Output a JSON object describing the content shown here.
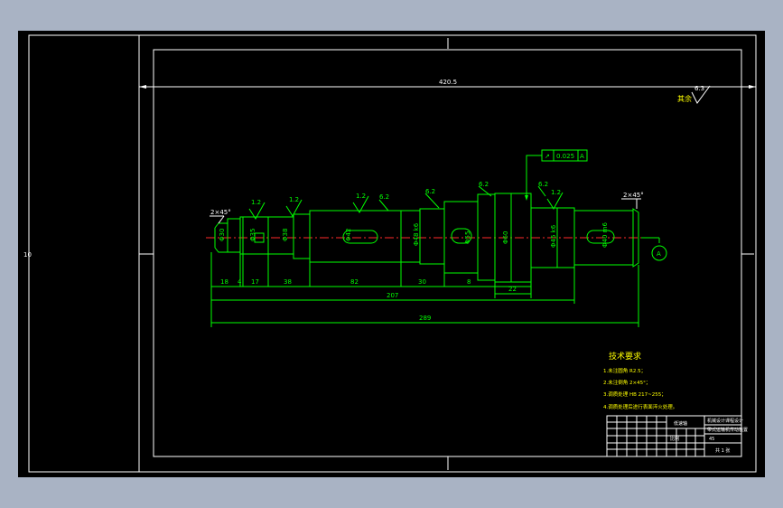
{
  "drawing": {
    "overall_width_dim": "420.5",
    "left_margin_mark": "10",
    "surface_finish_note": {
      "label": "其余",
      "value": "6.3"
    },
    "gdt_frame": {
      "symbol": "↗",
      "tolerance": "0.025",
      "datum": "A"
    },
    "chamfer_left": "2×45°",
    "chamfer_right": "2×45°",
    "roughness_marks": [
      "1.2",
      "1.2",
      "1.2",
      "1.2"
    ],
    "roughness_labels": [
      "6.2",
      "6.2",
      "6.2",
      "6.2"
    ],
    "diameter_labels": [
      "Φ30",
      "Φ35",
      "Φ38",
      "Φ42",
      "Φ48 k6",
      "Φ55",
      "Φ60",
      "Φ45 k6",
      "Φ40 m6"
    ],
    "segment_dims": [
      "18",
      "4",
      "17",
      "38",
      "82",
      "30",
      "8"
    ],
    "sub_dims": [
      "22",
      "207"
    ],
    "total_length": "289",
    "datum_label": "A",
    "tech_requirements": {
      "title": "技术要求",
      "items": [
        "1.未注圆角 R2.5；",
        "2.未注倒角 2×45°；",
        "3.调质处理 HB 217~255；",
        "4.调质处理后进行表面淬火处理。"
      ]
    },
    "title_block": {
      "part_name": "低速轴",
      "school": "机械设计课程设计",
      "drawing_title": "带式运输机传动装置",
      "scale_label": "比例",
      "material": "45",
      "sheet": "共 1 张"
    }
  }
}
